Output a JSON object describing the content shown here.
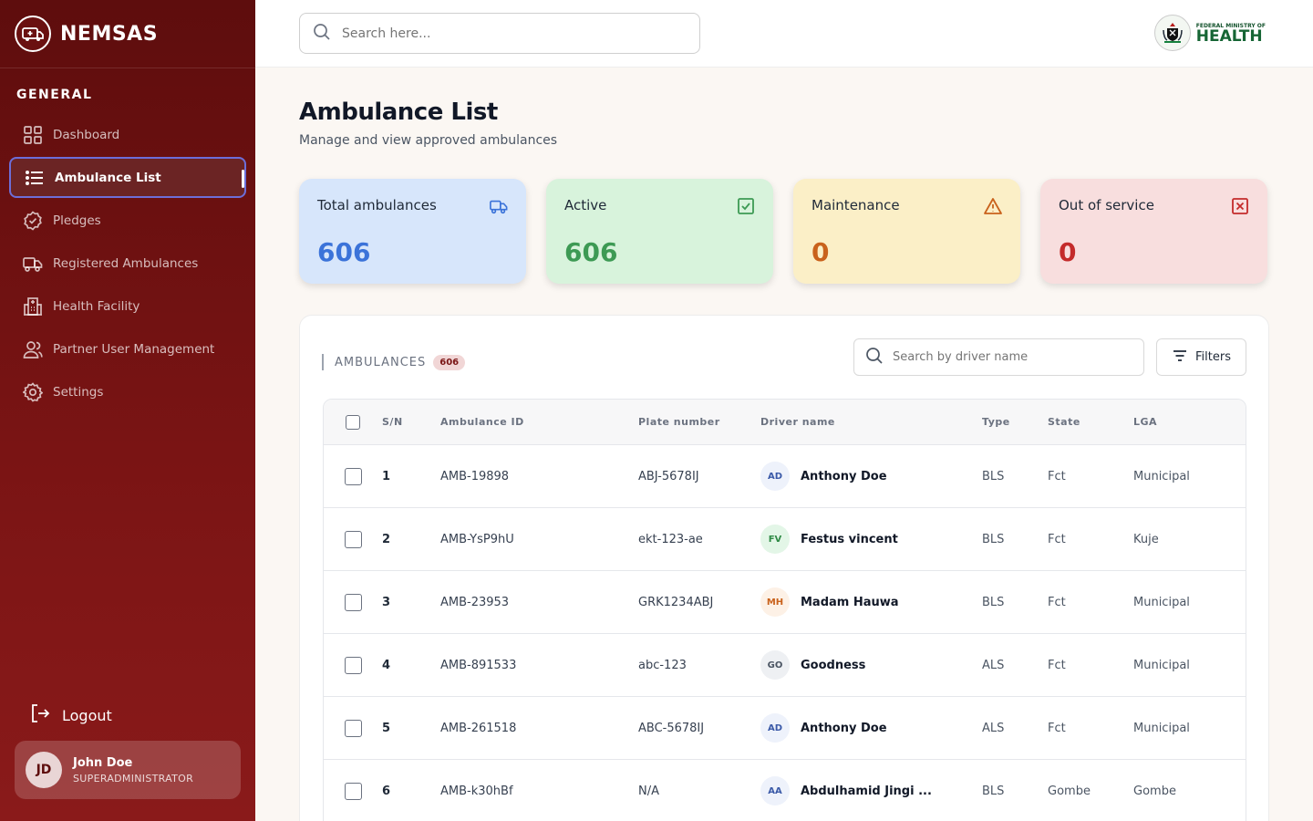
{
  "brand": {
    "name": "NEMSAS"
  },
  "sidebar": {
    "section_label": "GENERAL",
    "items": [
      {
        "label": "Dashboard",
        "icon": "grid-icon",
        "active": false
      },
      {
        "label": "Ambulance List",
        "icon": "list-icon",
        "active": true
      },
      {
        "label": "Pledges",
        "icon": "badge-check-icon",
        "active": false
      },
      {
        "label": "Registered Ambulances",
        "icon": "truck-icon",
        "active": false
      },
      {
        "label": "Health Facility",
        "icon": "building-icon",
        "active": false
      },
      {
        "label": "Partner User Management",
        "icon": "users-icon",
        "active": false
      },
      {
        "label": "Settings",
        "icon": "gear-icon",
        "active": false
      }
    ],
    "logout_label": "Logout",
    "user": {
      "initials": "JD",
      "name": "John Doe",
      "role": "SUPERADMINISTRATOR"
    }
  },
  "topbar": {
    "search_placeholder": "Search here...",
    "ministry_small": "FEDERAL MINISTRY OF",
    "ministry_big": "HEALTH"
  },
  "page": {
    "title": "Ambulance List",
    "subtitle": "Manage and view approved ambulances"
  },
  "stats": [
    {
      "label": "Total ambulances",
      "value": "606",
      "icon": "truck-icon",
      "bg": "#d7e6fb",
      "color": "#3b73d9"
    },
    {
      "label": "Active",
      "value": "606",
      "icon": "check-square-icon",
      "bg": "#d8f3dc",
      "color": "#3d9a54"
    },
    {
      "label": "Maintenance",
      "value": "0",
      "icon": "warning-icon",
      "bg": "#fbefc7",
      "color": "#c9621c"
    },
    {
      "label": "Out of service",
      "value": "0",
      "icon": "x-square-icon",
      "bg": "#f8dede",
      "color": "#c42b2b"
    }
  ],
  "panel": {
    "label": "AMBULANCES",
    "count": "606",
    "driver_search_placeholder": "Search by driver name",
    "filters_label": "Filters"
  },
  "table": {
    "columns": [
      "S/N",
      "Ambulance ID",
      "Plate number",
      "Driver name",
      "Type",
      "State",
      "LGA"
    ],
    "rows": [
      {
        "sn": "1",
        "id": "AMB-19898",
        "plate": "ABJ-5678IJ",
        "initials": "AD",
        "driver": "Anthony Doe",
        "type": "BLS",
        "state": "Fct",
        "lga": "Municipal",
        "avatar_bg": "#eef2fb",
        "avatar_color": "#3b5aa8"
      },
      {
        "sn": "2",
        "id": "AMB-YsP9hU",
        "plate": "ekt-123-ae",
        "initials": "FV",
        "driver": "Festus vincent",
        "type": "BLS",
        "state": "Fct",
        "lga": "Kuje",
        "avatar_bg": "#e3f6e7",
        "avatar_color": "#2f8a45"
      },
      {
        "sn": "3",
        "id": "AMB-23953",
        "plate": "GRK1234ABJ",
        "initials": "MH",
        "driver": "Madam Hauwa",
        "type": "BLS",
        "state": "Fct",
        "lga": "Municipal",
        "avatar_bg": "#fdf1e6",
        "avatar_color": "#c9621c"
      },
      {
        "sn": "4",
        "id": "AMB-891533",
        "plate": "abc-123",
        "initials": "GO",
        "driver": "Goodness",
        "type": "ALS",
        "state": "Fct",
        "lga": "Municipal",
        "avatar_bg": "#eef0f3",
        "avatar_color": "#4b5563"
      },
      {
        "sn": "5",
        "id": "AMB-261518",
        "plate": "ABC-5678IJ",
        "initials": "AD",
        "driver": "Anthony Doe",
        "type": "ALS",
        "state": "Fct",
        "lga": "Municipal",
        "avatar_bg": "#eef2fb",
        "avatar_color": "#3b5aa8"
      },
      {
        "sn": "6",
        "id": "AMB-k30hBf",
        "plate": "N/A",
        "initials": "AA",
        "driver": "Abdulhamid Jingi ...",
        "type": "BLS",
        "state": "Gombe",
        "lga": "Gombe",
        "avatar_bg": "#eef2fb",
        "avatar_color": "#3b5aa8"
      }
    ]
  }
}
